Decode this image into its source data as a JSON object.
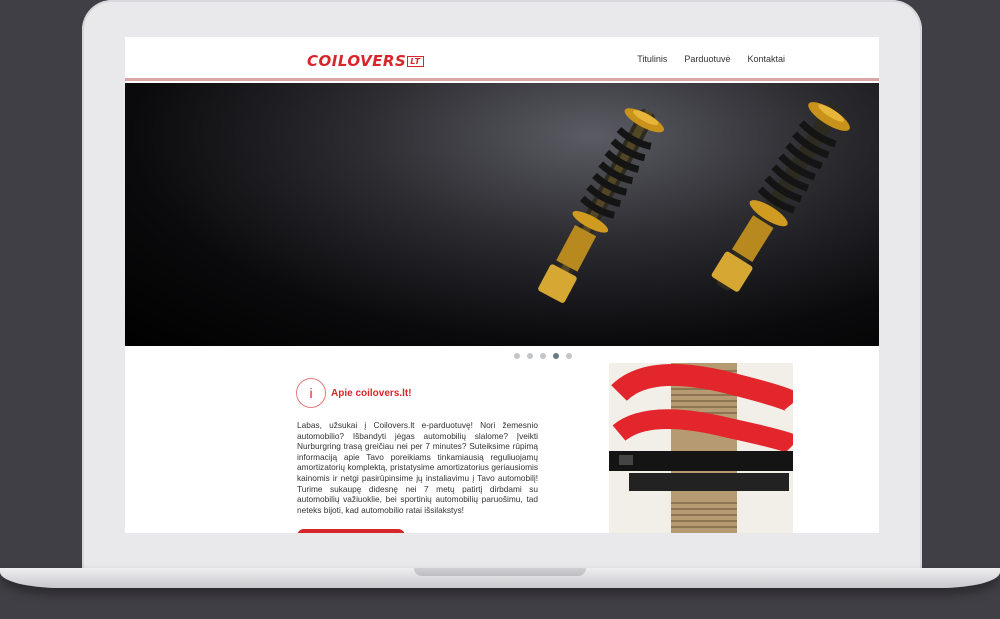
{
  "header": {
    "logo_main": "COILOVERS",
    "logo_tld": "LT",
    "nav": [
      "Titulinis",
      "Parduotuvė",
      "Kontaktai"
    ]
  },
  "slider": {
    "dots": 5,
    "active_dot": 4
  },
  "about": {
    "title": "Apie coilovers.lt!",
    "body": "Labas, užsukai į Coilovers.lt e-parduotuvę! Nori žemesnio automobilio? Išbandyti jėgas automobilių slalome? Įveikti Nurburgring trasą greičiau nei per 7 minutes? Suteiksime rūpimą informaciją apie Tavo poreikiams tinkamiausią reguliuojamų amortizatorių komplektą, pristatysime amortizatorius geriausiomis kainomis ir netgi pasirūpinsime jų instaliavimu į Tavo automobilį! Turime sukaupę didesnę nei 7 metų patirtį dirbdami su automobilių važiuoklie, bei sportinių automobilių paruošimu, tad neteks bijoti, kad automobilio ratai išsilakstys!"
  },
  "colors": {
    "accent": "#d7262b",
    "frame": "#e9e9ec",
    "background": "#403f45"
  }
}
